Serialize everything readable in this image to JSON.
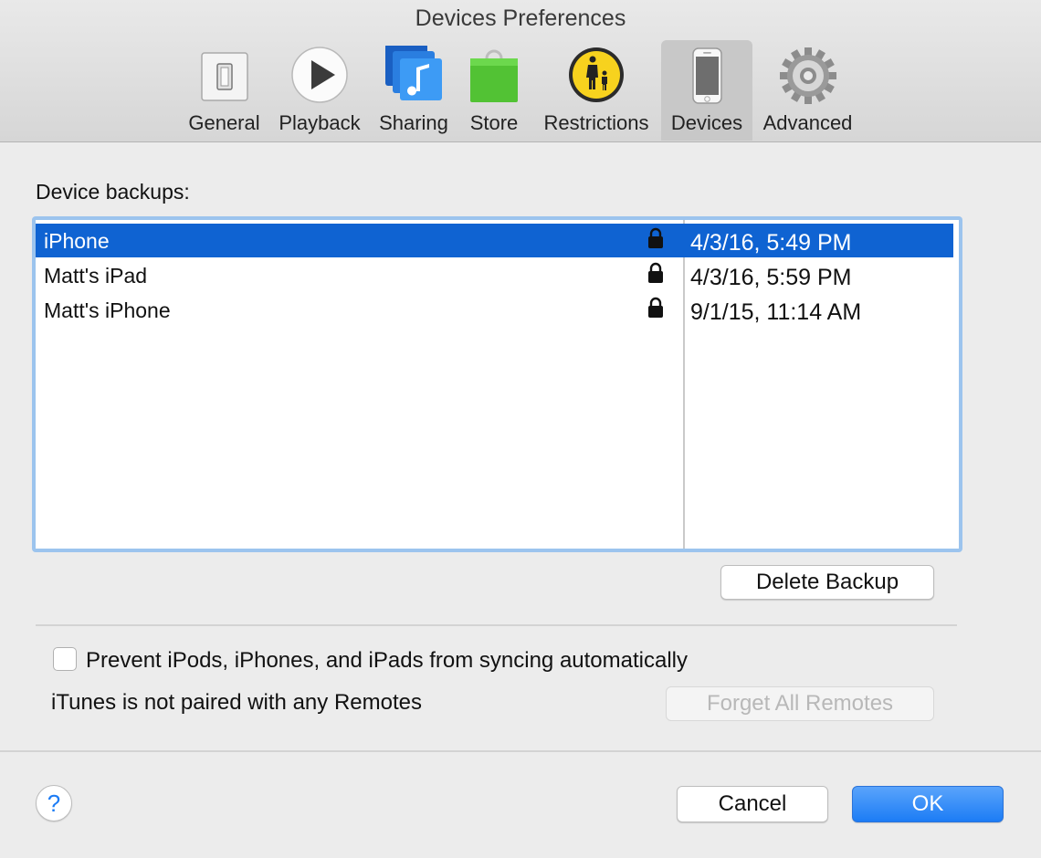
{
  "window": {
    "title": "Devices Preferences"
  },
  "toolbar": {
    "tabs": [
      {
        "label": "General",
        "icon": "switch-icon"
      },
      {
        "label": "Playback",
        "icon": "play-icon"
      },
      {
        "label": "Sharing",
        "icon": "music-share-icon"
      },
      {
        "label": "Store",
        "icon": "shopping-bag-icon"
      },
      {
        "label": "Restrictions",
        "icon": "parental-controls-icon"
      },
      {
        "label": "Devices",
        "icon": "iphone-icon",
        "selected": true
      },
      {
        "label": "Advanced",
        "icon": "gear-icon"
      }
    ]
  },
  "backups": {
    "label": "Device backups:",
    "rows": [
      {
        "name": "iPhone",
        "date": "4/3/16, 5:49 PM",
        "locked": true,
        "selected": true
      },
      {
        "name": "Matt's iPad",
        "date": "4/3/16, 5:59 PM",
        "locked": true,
        "selected": false
      },
      {
        "name": "Matt's iPhone",
        "date": "9/1/15, 11:14 AM",
        "locked": true,
        "selected": false
      }
    ],
    "delete_label": "Delete Backup"
  },
  "sync": {
    "prevent_label": "Prevent iPods, iPhones, and iPads from syncing automatically",
    "prevent_checked": false
  },
  "remotes": {
    "status": "iTunes is not paired with any Remotes",
    "forget_label": "Forget All Remotes"
  },
  "footer": {
    "help_label": "?",
    "cancel_label": "Cancel",
    "ok_label": "OK"
  },
  "colors": {
    "selection": "#0f63d2",
    "list_focus_ring": "#9cc4ee",
    "primary_button": "#1c7cf5"
  }
}
